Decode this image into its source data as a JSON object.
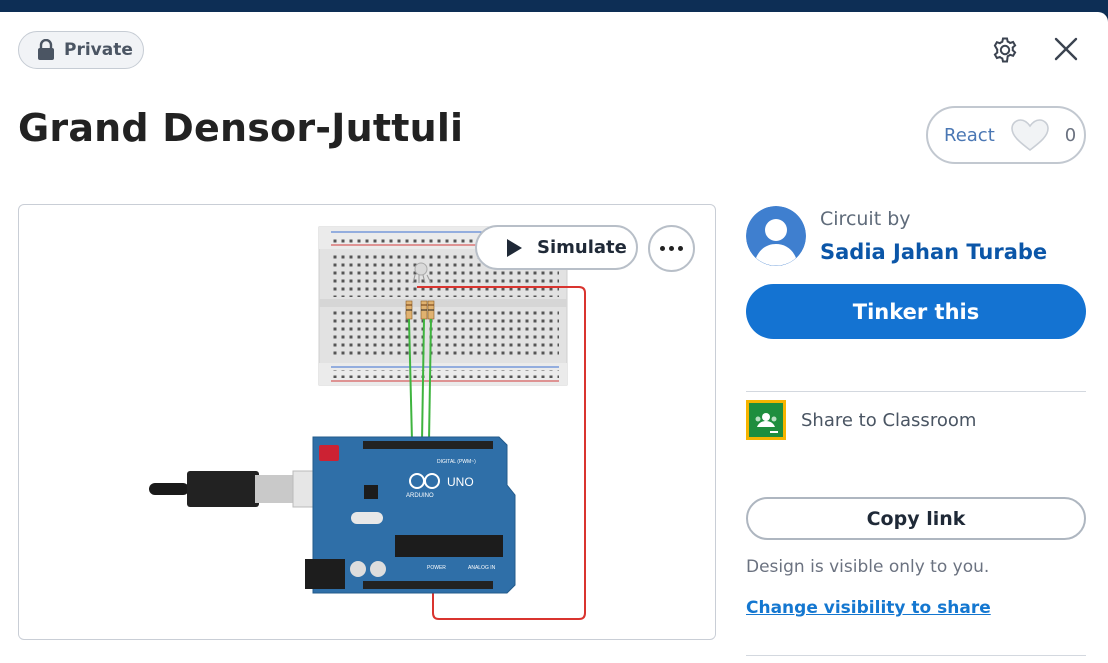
{
  "header": {
    "visibility_label": "Private",
    "settings_icon": "gear-icon",
    "close_icon": "close-icon"
  },
  "design": {
    "title": "Grand Densor-Juttuli"
  },
  "react": {
    "label": "React",
    "count": "0",
    "icon": "heart-icon"
  },
  "canvas": {
    "simulate_label": "Simulate",
    "more_icon": "more-options-icon"
  },
  "author": {
    "circuit_by": "Circuit by",
    "name": "Sadia Jahan Turabe"
  },
  "actions": {
    "tinker_label": "Tinker this",
    "classroom_label": "Share to Classroom",
    "copy_link_label": "Copy link",
    "visibility_note": "Design is visible only to you.",
    "change_visibility_label": "Change visibility to share"
  },
  "colors": {
    "primary": "#1473d2",
    "link": "#0b56a8",
    "topbar": "#0d2e55",
    "classroom_green": "#1e8e3e",
    "classroom_yellow": "#f6b400"
  }
}
